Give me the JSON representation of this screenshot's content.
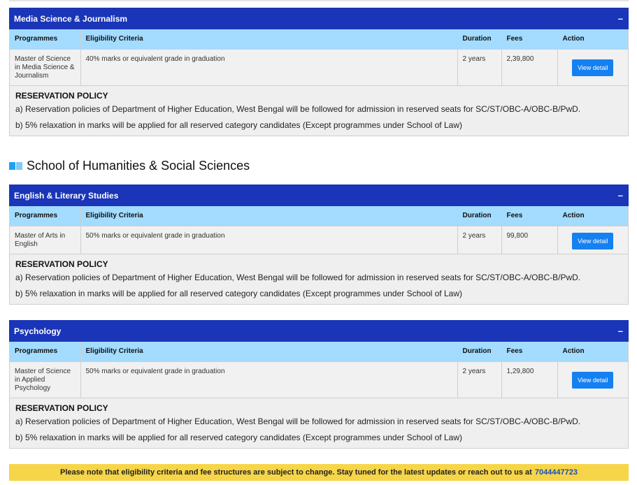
{
  "headers": {
    "programmes": "Programmes",
    "eligibility": "Eligibility Criteria",
    "duration": "Duration",
    "fees": "Fees",
    "action": "Action"
  },
  "toggle_symbol": "–",
  "view_detail_label": "View detail",
  "policy": {
    "title": "RESERVATION POLICY",
    "line_a": "a) Reservation policies of Department of Higher Education, West Bengal will be followed for admission in reserved seats for SC/ST/OBC-A/OBC-B/PwD.",
    "line_b": "b) 5% relaxation in marks will be applied for all reserved category candidates (Except programmes under School of Law)"
  },
  "sections": [
    {
      "title": "Media Science & Journalism",
      "programme": "Master of Science in Media Science & Journalism",
      "eligibility": "40% marks or equivalent grade in graduation",
      "duration": "2 years",
      "fees": "2,39,800"
    },
    {
      "title": "English & Literary Studies",
      "programme": "Master of Arts in English",
      "eligibility": "50% marks or equivalent grade in graduation",
      "duration": "2 years",
      "fees": "99,800"
    },
    {
      "title": "Psychology",
      "programme": "Master of Science in Applied Psychology",
      "eligibility": "50% marks or equivalent grade in graduation",
      "duration": "2 years",
      "fees": "1,29,800"
    }
  ],
  "school": {
    "title": "School of Humanities & Social Sciences"
  },
  "notice": {
    "text": "Please note that eligibility criteria and fee structures are subject to change. Stay tuned for the latest updates or reach out to us at",
    "phone": "7044447723"
  },
  "colors": {
    "header_bar": "#1a35b8",
    "table_header": "#a3dcff",
    "button": "#1580f0",
    "notice_bg": "#f7d548",
    "phone_link": "#1a4fb4"
  }
}
